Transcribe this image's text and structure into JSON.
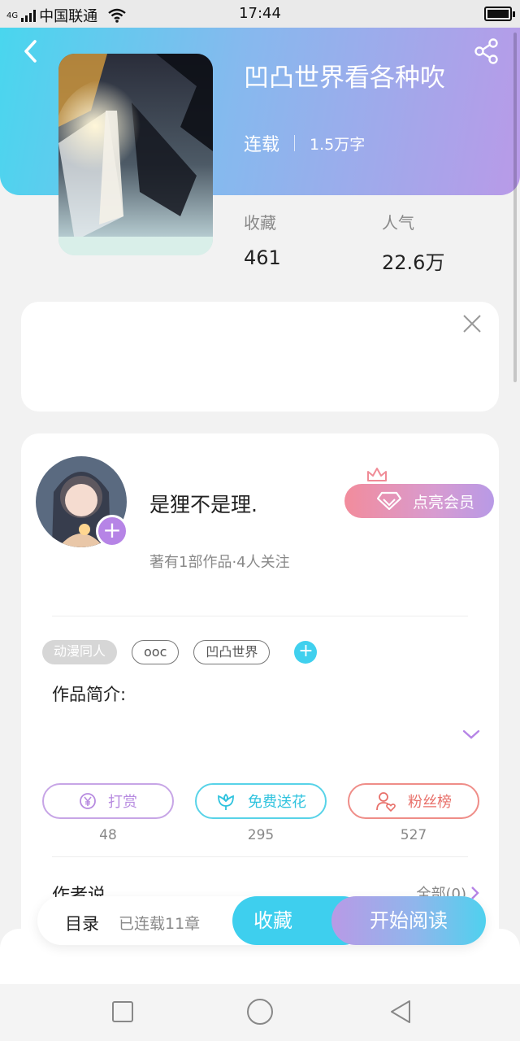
{
  "status_bar": {
    "network": "4G",
    "carrier": "中国联通",
    "time": "17:44",
    "battery_level": 1.0
  },
  "book": {
    "title": "凹凸世界看各种吹",
    "status": "连载",
    "word_count": "1.5万字",
    "stats": [
      {
        "label": "收藏",
        "value": "461"
      },
      {
        "label": "人气",
        "value": "22.6万"
      }
    ]
  },
  "author": {
    "name": "是狸不是理.",
    "subtitle": "著有1部作品·4人关注",
    "vip_label": "点亮会员"
  },
  "tags": [
    "动漫同人",
    "ooc",
    "凹凸世界"
  ],
  "intro_label": "作品简介:",
  "actions": [
    {
      "label": "打赏",
      "count": "48",
      "color": "#b78be0",
      "icon": "yen-coin-icon"
    },
    {
      "label": "免费送花",
      "count": "295",
      "color": "#3ecfe6",
      "icon": "flower-icon"
    },
    {
      "label": "粉丝榜",
      "count": "527",
      "color": "#ea6f6a",
      "icon": "person-heart-icon"
    }
  ],
  "author_says": {
    "label": "作者说",
    "all_label": "全部(0)"
  },
  "read_bar": {
    "toc_label": "目录",
    "chapters_label": "已连载11章",
    "favorite_label": "收藏",
    "read_label": "开始阅读"
  },
  "colors": {
    "header_gradient_start": "#49d6ee",
    "header_gradient_end": "#b99ae8",
    "accent_cyan": "#3ecfee",
    "accent_purple": "#b684e6"
  }
}
